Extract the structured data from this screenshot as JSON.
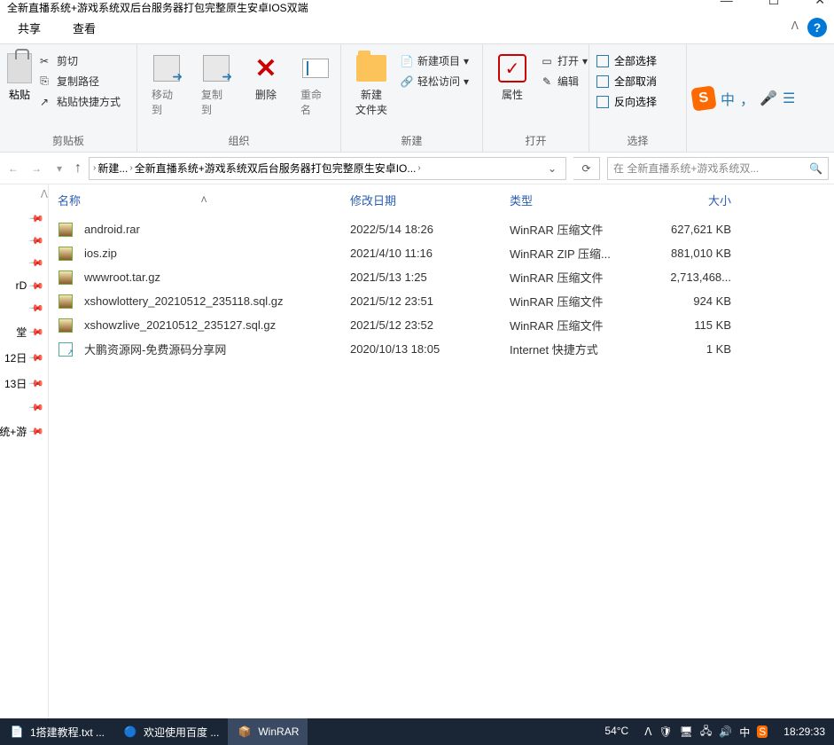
{
  "window": {
    "title": "全新直播系统+游戏系统双后台服务器打包完整原生安卓IOS双端"
  },
  "tabs": {
    "share": "共享",
    "view": "查看"
  },
  "ribbon": {
    "clipboard": {
      "title": "剪贴板",
      "paste": "粘贴",
      "cut": "剪切",
      "copy_path": "复制路径",
      "paste_shortcut": "粘贴快捷方式"
    },
    "organize": {
      "title": "组织",
      "move_to": "移动到",
      "copy_to": "复制到",
      "delete": "删除",
      "rename": "重命名"
    },
    "new": {
      "title": "新建",
      "new_folder": "新建\n文件夹",
      "new_item": "新建项目",
      "easy_access": "轻松访问"
    },
    "open": {
      "title": "打开",
      "properties": "属性",
      "open": "打开",
      "edit": "编辑"
    },
    "select": {
      "title": "选择",
      "select_all": "全部选择",
      "select_none": "全部取消",
      "invert": "反向选择"
    },
    "ime": {
      "zhong": "中",
      "dot": "，",
      "mic": "🎤"
    }
  },
  "breadcrumb": {
    "items": [
      "新建...",
      "全新直播系统+游戏系统双后台服务器打包完整原生安卓IO..."
    ]
  },
  "search": {
    "placeholder": "在 全新直播系统+游戏系统双..."
  },
  "sidebar": {
    "items": [
      "",
      "",
      "",
      "rD",
      "",
      "堂",
      "12日",
      "13日",
      "",
      "统+游"
    ]
  },
  "columns": {
    "name": "名称",
    "date": "修改日期",
    "type": "类型",
    "size": "大小"
  },
  "files": [
    {
      "icon": "rar",
      "name": "android.rar",
      "date": "2022/5/14 18:26",
      "type": "WinRAR 压缩文件",
      "size": "627,621 KB"
    },
    {
      "icon": "rar",
      "name": "ios.zip",
      "date": "2021/4/10 11:16",
      "type": "WinRAR ZIP 压缩...",
      "size": "881,010 KB"
    },
    {
      "icon": "rar",
      "name": "wwwroot.tar.gz",
      "date": "2021/5/13 1:25",
      "type": "WinRAR 压缩文件",
      "size": "2,713,468..."
    },
    {
      "icon": "rar",
      "name": "xshowlottery_20210512_235118.sql.gz",
      "date": "2021/5/12 23:51",
      "type": "WinRAR 压缩文件",
      "size": "924 KB"
    },
    {
      "icon": "rar",
      "name": "xshowzlive_20210512_235127.sql.gz",
      "date": "2021/5/12 23:52",
      "type": "WinRAR 压缩文件",
      "size": "115 KB"
    },
    {
      "icon": "url",
      "name": "大鹏资源网-免费源码分享网",
      "date": "2020/10/13 18:05",
      "type": "Internet 快捷方式",
      "size": "1 KB"
    }
  ],
  "taskbar": {
    "items": [
      {
        "label": "1搭建教程.txt ..."
      },
      {
        "label": "欢迎使用百度 ..."
      },
      {
        "label": "WinRAR"
      }
    ],
    "weather": "54°C",
    "time": "18:29:33"
  }
}
